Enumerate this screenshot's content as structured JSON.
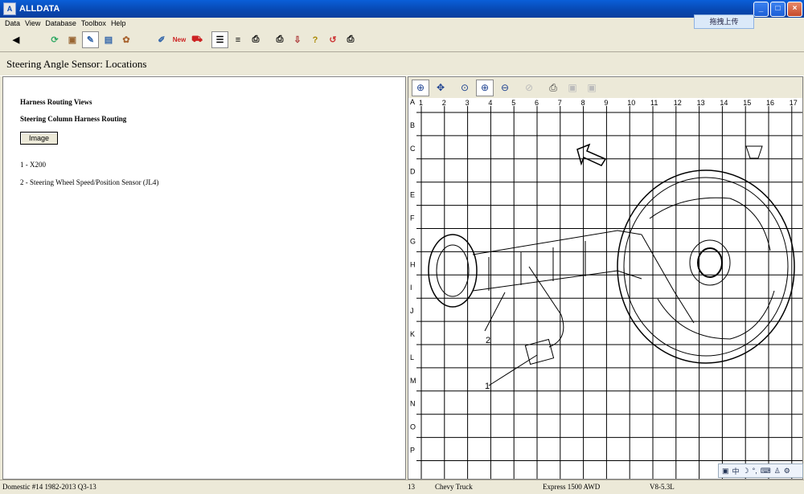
{
  "window": {
    "title": "ALLDATA",
    "upload_label": "拖拽上传"
  },
  "menu": [
    "Data",
    "View",
    "Database",
    "Toolbox",
    "Help"
  ],
  "page": {
    "title": "Steering Angle Sensor:  Locations"
  },
  "content": {
    "heading1": "Harness Routing Views",
    "heading2": "Steering Column Harness Routing",
    "image_button": "Image",
    "items": [
      "1 - X200",
      "2 - Steering Wheel Speed/Position Sensor (JL4)"
    ]
  },
  "grid": {
    "columns": [
      "1",
      "2",
      "3",
      "4",
      "5",
      "6",
      "7",
      "8",
      "9",
      "10",
      "11",
      "12",
      "13",
      "14",
      "15",
      "16",
      "17"
    ],
    "rows": [
      "A",
      "B",
      "C",
      "D",
      "E",
      "F",
      "G",
      "H",
      "I",
      "J",
      "K",
      "L",
      "M",
      "N",
      "O",
      "P"
    ],
    "callouts": [
      "1",
      "2"
    ]
  },
  "status": {
    "database": "Domestic #14 1982-2013 Q3-13",
    "code": "13",
    "make": "Chevy Truck",
    "model": "Express 1500 AWD",
    "engine": "V8-5.3L"
  },
  "ime": [
    "中"
  ],
  "colors": {
    "titlebar": "#0a5fd8",
    "chrome": "#ece9d8"
  }
}
